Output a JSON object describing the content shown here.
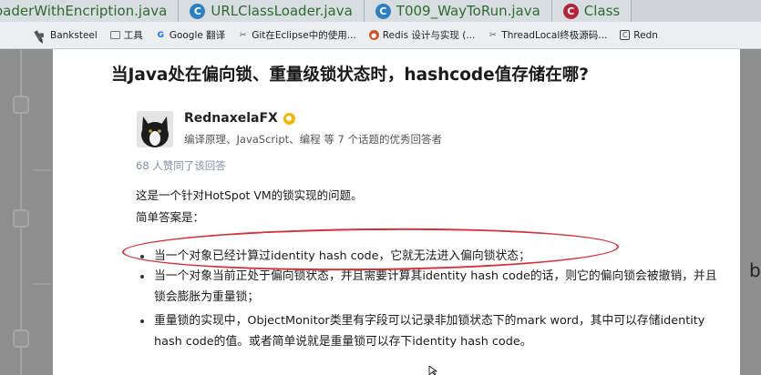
{
  "ide": {
    "tabs": [
      {
        "label": "oaderWithEncription.java",
        "icon": "java-class-icon"
      },
      {
        "label": "URLClassLoader.java",
        "icon": "java-class-icon"
      },
      {
        "label": "T009_WayToRun.java",
        "icon": "java-class-icon"
      },
      {
        "label": "Class",
        "icon": "java-class-red-icon"
      }
    ],
    "right_letter": "b",
    "icon_letter": "C"
  },
  "browser": {
    "bookmarks": [
      {
        "label": "Banksteel",
        "icon": "page-icon"
      },
      {
        "label": "工具",
        "icon": "folder-icon"
      },
      {
        "label": "Google 翻译",
        "icon": "google-icon"
      },
      {
        "label": "Git在Eclipse中的使用...",
        "icon": "git-icon"
      },
      {
        "label": "Redis 设计与实现 (...",
        "icon": "redis-icon"
      },
      {
        "label": "ThreadLocal终极源码...",
        "icon": "cc-icon"
      },
      {
        "label": "Redn",
        "icon": "cc-icon"
      }
    ]
  },
  "article": {
    "question_title": "当Java处在偏向锁、重量级锁状态时，hashcode值存储在哪?",
    "author": {
      "name": "RednaxelaFX",
      "bio_prefix": "编译原理、JavaScript、编程",
      "bio_mid": "等 7 个话题的优秀回答者"
    },
    "votes": "68 人赞同了该回答",
    "intro": "这是一个针对HotSpot VM的锁实现的问题。",
    "short_answer": "简单答案是：",
    "bullets": [
      "当一个对象已经计算过identity hash code，它就无法进入偏向锁状态；",
      "当一个对象当前正处于偏向锁状态，并且需要计算其identity hash code的话，则它的偏向锁会被撤销，并且锁会膨胀为重量锁；",
      "重量锁的实现中，ObjectMonitor类里有字段可以记录非加锁状态下的mark word，其中可以存储identity hash code的值。或者简单说就是重量锁可以存下identity hash code。"
    ],
    "highlight_color": "#d2323c"
  }
}
